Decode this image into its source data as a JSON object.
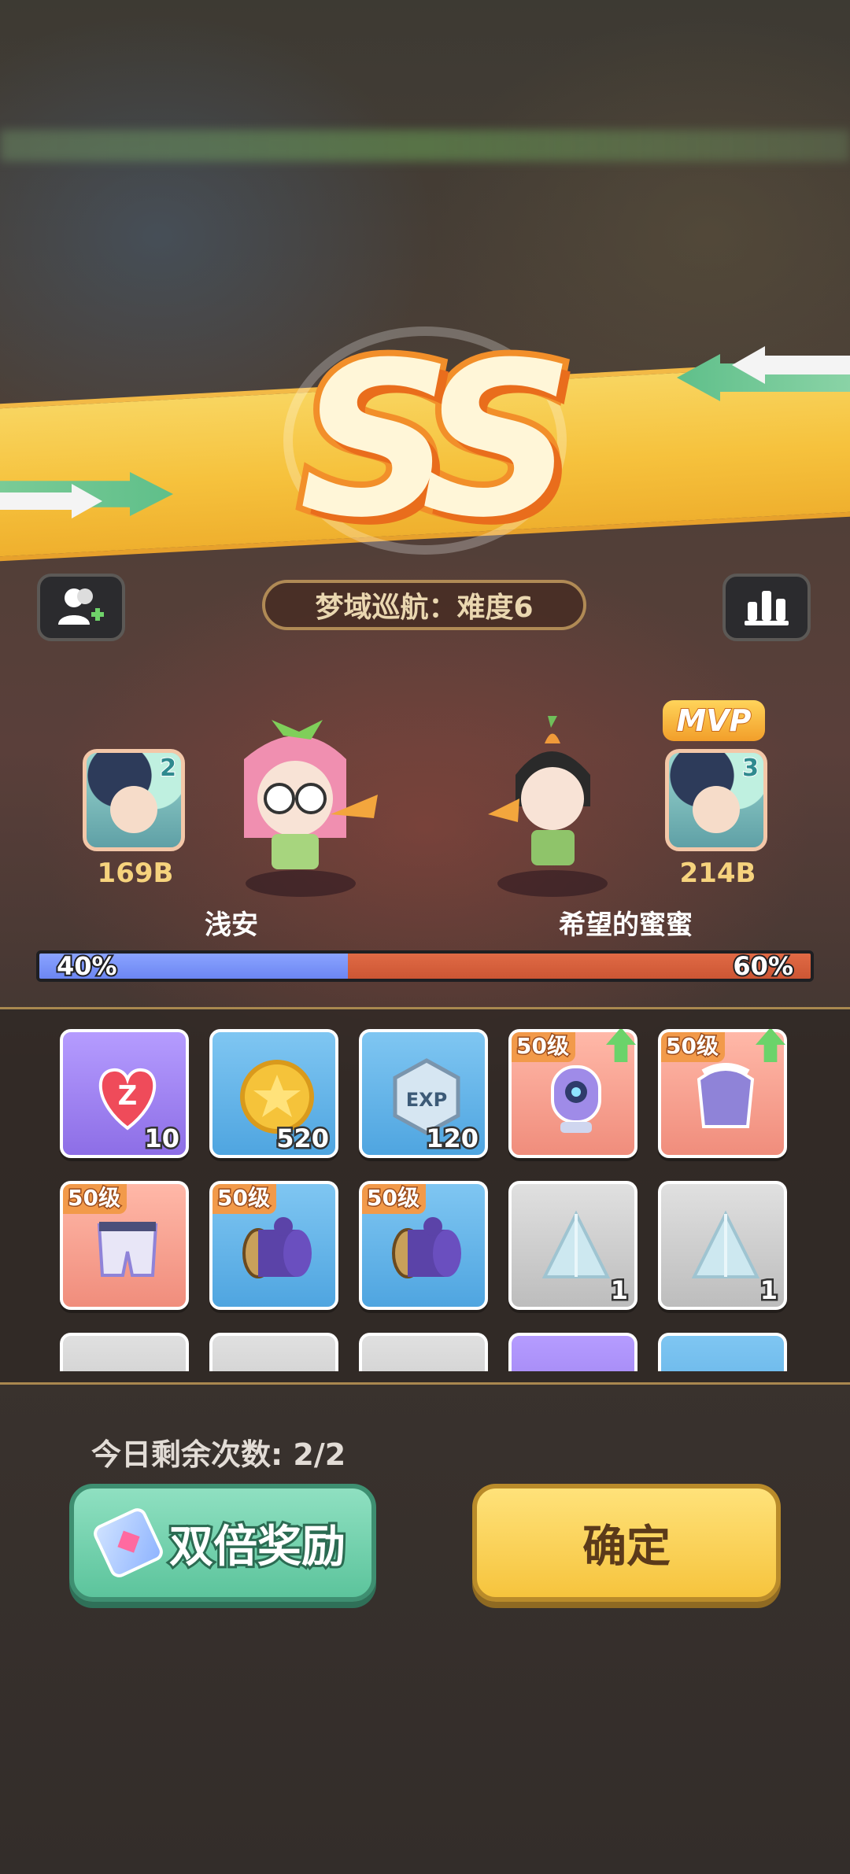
{
  "result": {
    "grade": "SS"
  },
  "header": {
    "stage_title": "梦域巡航：难度6",
    "add_friend_icon": "add-friend-icon",
    "stats_icon": "bar-chart-icon"
  },
  "players": [
    {
      "name": "浅安",
      "score": "169B",
      "rank": "2",
      "mvp": false
    },
    {
      "name": "希望的蜜蜜",
      "score": "214B",
      "rank": "3",
      "mvp": true,
      "mvp_label": "MVP"
    }
  ],
  "contribution": {
    "left_label": "40%",
    "right_label": "60%",
    "left_fraction": 0.4,
    "right_fraction": 0.6
  },
  "rewards": [
    {
      "type": "heart",
      "qty": "10",
      "level": ""
    },
    {
      "type": "coin",
      "qty": "520",
      "level": ""
    },
    {
      "type": "exp",
      "qty": "120",
      "level": ""
    },
    {
      "type": "eye-gear",
      "qty": "",
      "level": "50级",
      "upgrade": true
    },
    {
      "type": "jacket",
      "qty": "",
      "level": "50级",
      "upgrade": true
    },
    {
      "type": "shorts",
      "qty": "",
      "level": "50级"
    },
    {
      "type": "drum",
      "qty": "",
      "level": "50级"
    },
    {
      "type": "drum",
      "qty": "",
      "level": "50级"
    },
    {
      "type": "crystal",
      "qty": "1",
      "level": ""
    },
    {
      "type": "crystal",
      "qty": "1",
      "level": ""
    }
  ],
  "footer": {
    "remaining_text": "今日剩余次数: 2/2",
    "double_button": "双倍奖励",
    "confirm_button": "确定"
  },
  "colors": {
    "left_team": "#7b95f8",
    "right_team": "#d65e3c",
    "confirm": "#f6c43d",
    "double": "#6fd0aa"
  }
}
